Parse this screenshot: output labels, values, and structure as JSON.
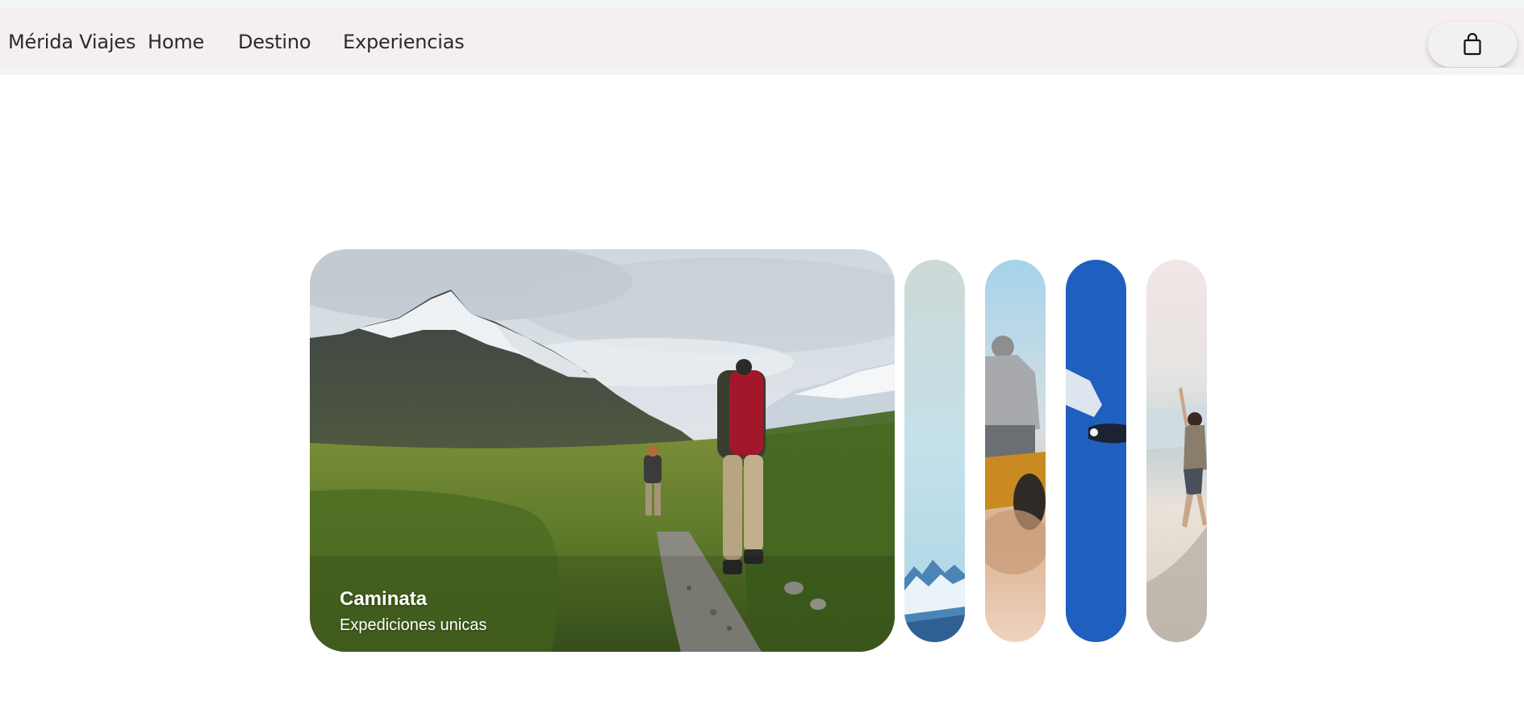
{
  "header": {
    "brand": "Mérida Viajes",
    "nav_items": [
      {
        "label": "Home"
      },
      {
        "label": "Destino"
      },
      {
        "label": "Experiencias"
      }
    ],
    "cart_icon": "shopping-bag-icon"
  },
  "gallery": {
    "active_panel": {
      "title": "Caminata",
      "subtitle": "Expediciones unicas"
    },
    "panels": [
      {
        "icon": "mountain-hikers-photo"
      },
      {
        "icon": "snowy-mountain-photo"
      },
      {
        "icon": "quad-bike-rider-photo"
      },
      {
        "icon": "skydiver-photo"
      },
      {
        "icon": "beach-people-photo"
      }
    ]
  },
  "colors": {
    "navbar_bg": "#f5efef",
    "text": "#2b2b2b",
    "panel_blue": "#1f5fbf"
  }
}
